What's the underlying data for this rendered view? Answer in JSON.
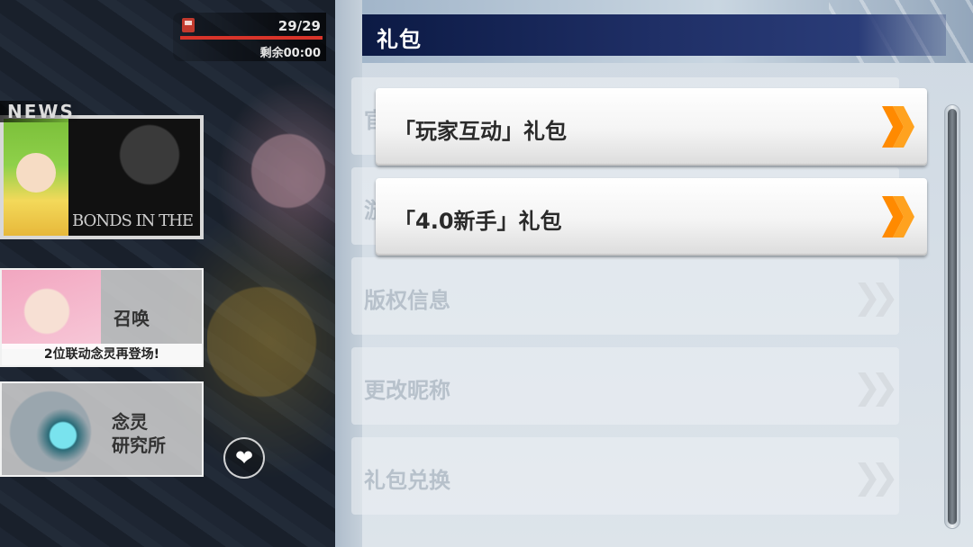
{
  "stamina": {
    "icon": "fuel-icon",
    "count": "29/29",
    "fill_fraction": 1.0,
    "timer": "剩余00:00"
  },
  "news": {
    "label": "NEWS",
    "banner_text": "BONDS IN THE"
  },
  "summon": {
    "title": "召唤",
    "subtitle": "2位联动念灵再登场!"
  },
  "lab": {
    "title_line1": "念灵",
    "title_line2": "研究所"
  },
  "panel": {
    "title": "礼包"
  },
  "background_menu": [
    {
      "label": "官"
    },
    {
      "label": "游"
    },
    {
      "label": "版权信息"
    },
    {
      "label": "更改昵称"
    },
    {
      "label": "礼包兑换"
    }
  ],
  "gift_buttons": [
    {
      "label": "「玩家互动」礼包"
    },
    {
      "label": "「4.0新手」礼包"
    }
  ],
  "colors": {
    "header": "#1f2f66",
    "chevron": "#ff8a00",
    "stamina_fill": "#d8342a"
  }
}
